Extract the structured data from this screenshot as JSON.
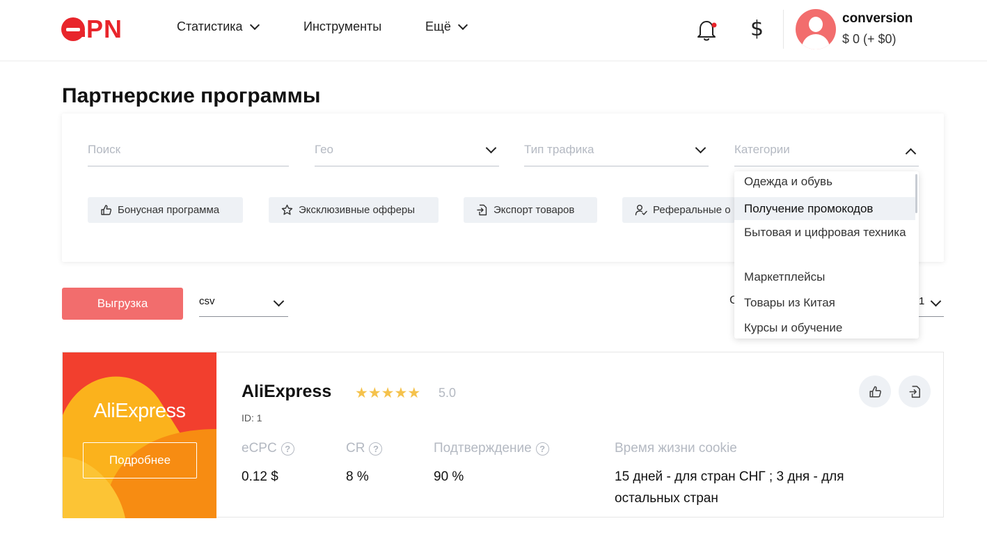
{
  "header": {
    "logo_text": "PN",
    "nav": [
      {
        "label": "Статистика",
        "has_dropdown": true
      },
      {
        "label": "Инструменты",
        "has_dropdown": false
      },
      {
        "label": "Ещё",
        "has_dropdown": true
      }
    ],
    "currency_symbol": "$",
    "user": {
      "name": "conversion",
      "balance": "$ 0 (+ $0)"
    }
  },
  "page_title": "Партнерские программы",
  "filters": {
    "search_placeholder": "Поиск",
    "geo_placeholder": "Гео",
    "traffic_placeholder": "Тип трафика",
    "categories_placeholder": "Категории",
    "chips": [
      {
        "label": "Бонусная программа",
        "icon": "thumb-up-icon"
      },
      {
        "label": "Эксклюзивные офферы",
        "icon": "star-icon"
      },
      {
        "label": "Экспорт товаров",
        "icon": "export-icon"
      },
      {
        "label": "Реферальные о",
        "icon": "user-check-icon"
      }
    ]
  },
  "categories_dropdown": {
    "items": [
      "Одежда и обувь",
      "Получение промокодов",
      "Бытовая и цифровая техника",
      "Маркетплейсы",
      "Товары из Китая",
      "Курсы и обучение"
    ],
    "active_index": 1
  },
  "export": {
    "button_label": "Выгрузка",
    "format": "csv"
  },
  "sort_fragment": {
    "left": "С",
    "right": "1"
  },
  "offer": {
    "image_logo_text": "AliExpress",
    "more_label": "Подробнее",
    "name": "AliExpress",
    "rating_stars": 5,
    "rating": "5.0",
    "id_text": "ID: 1",
    "metrics": [
      {
        "label": "eCPC",
        "value": "0.12 $",
        "help": true
      },
      {
        "label": "CR",
        "value": "8 %",
        "help": true
      },
      {
        "label": "Подтверждение",
        "value": "90 %",
        "help": true
      },
      {
        "label": "Время жизни cookie",
        "value": "15 дней - для стран СНГ ; 3 дня - для остальных стран",
        "help": false
      }
    ]
  },
  "colors": {
    "brand_red": "#e8252b",
    "button_coral": "#f26d6d",
    "star": "#f5c24c",
    "muted": "#b4b9c2",
    "chip_bg": "#eef1f5"
  }
}
